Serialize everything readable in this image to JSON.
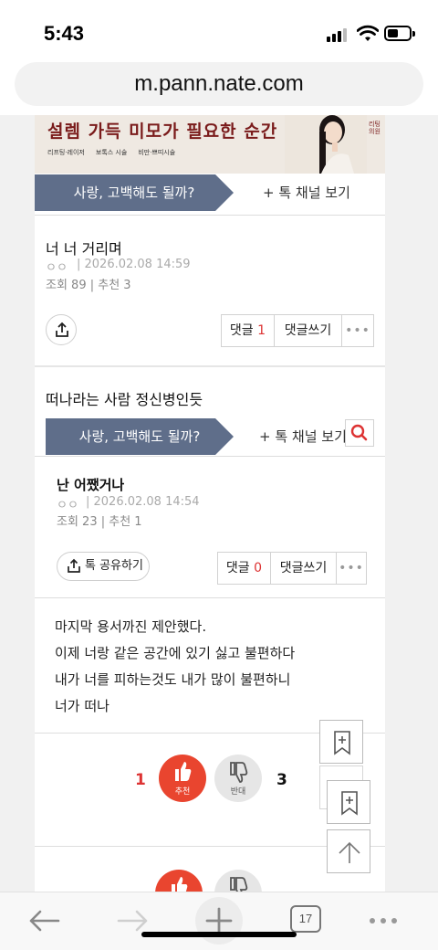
{
  "status_bar": {
    "time": "5:43"
  },
  "browser": {
    "url": "m.pann.nate.com",
    "tab_count": "17"
  },
  "ad": {
    "headline": "설렘 가득 미모가 필요한 순간",
    "tags": [
      "리프팅·레이저",
      "보톡스 시술",
      "비만·쁘띠시술"
    ],
    "brand": "리팅의원"
  },
  "channel": {
    "name": "사랑, 고백해도 될까?",
    "view_label": "+ 톡 채널 보기"
  },
  "post1": {
    "title": "너 너 거리며",
    "author": "ㅇㅇ",
    "datetime": "| 2026.02.08 14:59",
    "stats": "조회 89 | 추천 3",
    "comment_label": "댓글",
    "comment_count": "1",
    "write_label": "댓글쓰기",
    "more": "•••"
  },
  "post2_heading": "떠나라는 사람 정신병인듯",
  "post2": {
    "title": "난 어쨌거나",
    "author": "ㅇㅇ",
    "datetime": "| 2026.02.08 14:54",
    "stats": "조회 23 | 추천 1",
    "share_label": "톡 공유하기",
    "comment_label": "댓글",
    "comment_count": "0",
    "write_label": "댓글쓰기",
    "more": "•••",
    "body": [
      "마지막 용서까진 제안했다.",
      "이제 너랑 같은 공간에 있기 싫고 불편하다",
      "내가 너를 피하는것도 내가 많이 불편하니",
      "너가 떠나"
    ],
    "recommend_label": "추천",
    "oppose_label": "반대",
    "recommend_count": "1",
    "oppose_count": "3"
  },
  "colors": {
    "accent": "#e9452f",
    "channel": "#5f6e8a",
    "ad_text": "#7a1b1b"
  }
}
